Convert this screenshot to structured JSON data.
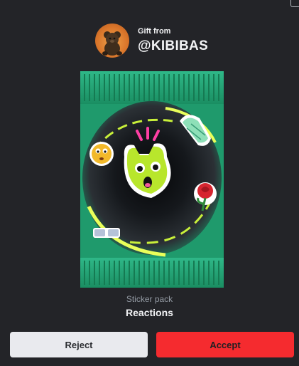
{
  "gift": {
    "from_label": "Gift from",
    "username": "@KIBIBAS"
  },
  "pack": {
    "type_label": "Sticker pack",
    "name": "Reactions",
    "icon": "sticker-pack-illustration"
  },
  "actions": {
    "reject_label": "Reject",
    "accept_label": "Accept"
  },
  "colors": {
    "background": "#232428",
    "accept": "#f52b2f",
    "reject": "#e9eaee",
    "pack_green": "#1f9a6c"
  }
}
